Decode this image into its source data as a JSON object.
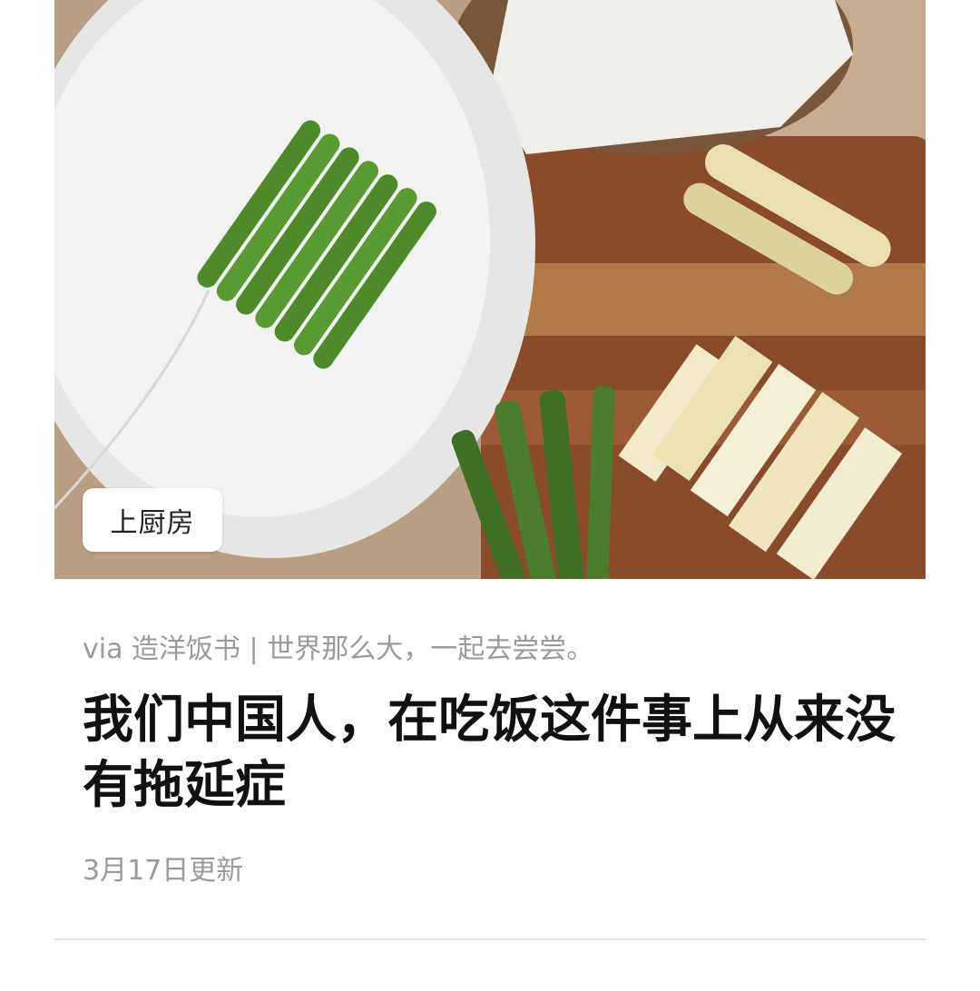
{
  "article": {
    "source_badge": "上厨房",
    "via": "via 造洋饭书 | 世界那么大，一起去尝尝。",
    "title": "我们中国人，在吃饭这件事上从来没有拖延症",
    "updated": "3月17日更新",
    "photo_icon": "food-photo"
  },
  "colors": {
    "title": "#111111",
    "meta": "#9a9a9a",
    "divider": "#e3e3e3",
    "badge_bg": "#ffffff"
  }
}
